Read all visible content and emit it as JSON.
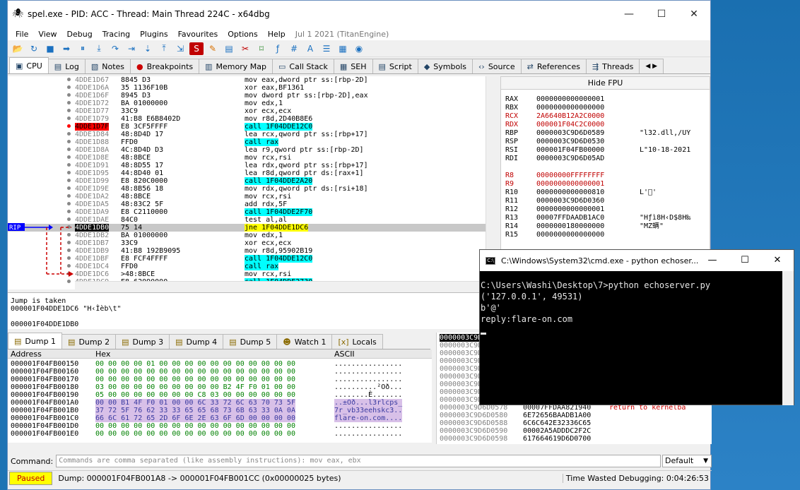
{
  "window": {
    "title": "spel.exe - PID: ACC - Thread: Main Thread 224C - x64dbg"
  },
  "menu": {
    "items": [
      "File",
      "View",
      "Debug",
      "Tracing",
      "Plugins",
      "Favourites",
      "Options",
      "Help"
    ],
    "version": "Jul 1 2021 (TitanEngine)"
  },
  "toolbar": {
    "icons": [
      "open-icon",
      "restart-icon",
      "stop-icon",
      "run-icon",
      "pause-icon",
      "step-into-icon",
      "step-over-icon",
      "trace-into-icon",
      "trace-over-icon",
      "execute-till-return-icon",
      "run-to-user-code-icon",
      "scylla-icon",
      "patch-icon",
      "comment-icon",
      "label-icon",
      "bookmark-icon",
      "function-icon",
      "hash-icon",
      "font-icon",
      "strings-icon",
      "calculator-icon",
      "help-icon"
    ]
  },
  "tabs": [
    {
      "icon": "cpu-icon",
      "label": "CPU",
      "active": true
    },
    {
      "icon": "log-icon",
      "label": "Log"
    },
    {
      "icon": "notes-icon",
      "label": "Notes"
    },
    {
      "icon": "breakpoint-icon",
      "label": "Breakpoints"
    },
    {
      "icon": "memory-icon",
      "label": "Memory Map"
    },
    {
      "icon": "callstack-icon",
      "label": "Call Stack"
    },
    {
      "icon": "seh-icon",
      "label": "SEH"
    },
    {
      "icon": "script-icon",
      "label": "Script"
    },
    {
      "icon": "symbols-icon",
      "label": "Symbols"
    },
    {
      "icon": "source-icon",
      "label": "Source"
    },
    {
      "icon": "references-icon",
      "label": "References"
    },
    {
      "icon": "threads-icon",
      "label": "Threads"
    }
  ],
  "disasm": [
    {
      "addr": "4DDE1D67",
      "bytes": "8845 D3",
      "ins": "mov eax,dword ptr ss:[rbp-2D]"
    },
    {
      "addr": "4DDE1D6A",
      "bytes": "35 1136F10B",
      "ins": "xor eax,BF1361"
    },
    {
      "addr": "4DDE1D6F",
      "bytes": "8945 D3",
      "ins": "mov dword ptr ss:[rbp-2D],eax"
    },
    {
      "addr": "4DDE1D72",
      "bytes": "BA 01000000",
      "ins": "mov edx,1"
    },
    {
      "addr": "4DDE1D77",
      "bytes": "33C9",
      "ins": "xor ecx,ecx"
    },
    {
      "addr": "4DDE1D79",
      "bytes": "41:B8 E6B8402D",
      "ins": "mov r8d,2D40B8E6"
    },
    {
      "addr": "4DDE1D7F",
      "bytes": "E8 3CF5FFFF",
      "ins": "call 1F04DDE12C0",
      "call": true,
      "bp": true
    },
    {
      "addr": "4DDE1D84",
      "bytes": "48:8D4D 17",
      "ins": "lea rcx,qword ptr ss:[rbp+17]"
    },
    {
      "addr": "4DDE1D88",
      "bytes": "FFD0",
      "ins": "call rax",
      "call": true
    },
    {
      "addr": "4DDE1D8A",
      "bytes": "4C:8D4D D3",
      "ins": "lea r9,qword ptr ss:[rbp-2D]"
    },
    {
      "addr": "4DDE1D8E",
      "bytes": "48:8BCE",
      "ins": "mov rcx,rsi"
    },
    {
      "addr": "4DDE1D91",
      "bytes": "48:8D55 17",
      "ins": "lea rdx,qword ptr ss:[rbp+17]"
    },
    {
      "addr": "4DDE1D95",
      "bytes": "44:8D40 01",
      "ins": "lea r8d,qword ptr ds:[rax+1]"
    },
    {
      "addr": "4DDE1D99",
      "bytes": "E8 820C0000",
      "ins": "call 1F04DDE2A20",
      "call": true
    },
    {
      "addr": "4DDE1D9E",
      "bytes": "48:8B56 18",
      "ins": "mov rdx,qword ptr ds:[rsi+18]"
    },
    {
      "addr": "4DDE1DA2",
      "bytes": "48:8BCE",
      "ins": "mov rcx,rsi"
    },
    {
      "addr": "4DDE1DA5",
      "bytes": "48:83C2 5F",
      "ins": "add rdx,5F"
    },
    {
      "addr": "4DDE1DA9",
      "bytes": "E8 C2110000",
      "ins": "call 1F04DDE2F70",
      "call": true
    },
    {
      "addr": "4DDE1DAE",
      "bytes": "84C0",
      "ins": "test al,al"
    },
    {
      "addr": "4DDE1DB0",
      "bytes": "75 14",
      "ins": "jne 1F04DDE1DC6",
      "jmp": true,
      "rip": true
    },
    {
      "addr": "4DDE1DB2",
      "bytes": "BA 01000000",
      "ins": "mov edx,1"
    },
    {
      "addr": "4DDE1DB7",
      "bytes": "33C9",
      "ins": "xor ecx,ecx"
    },
    {
      "addr": "4DDE1DB9",
      "bytes": "41:B8 192B9095",
      "ins": "mov r8d,95902B19"
    },
    {
      "addr": "4DDE1DBF",
      "bytes": "E8 FCF4FFFF",
      "ins": "call 1F04DDE12C0",
      "call": true
    },
    {
      "addr": "4DDE1DC4",
      "bytes": "FFD0",
      "ins": "call rax",
      "call": true
    },
    {
      "addr": "4DDE1DC6",
      "bytes": ">48:8BCE",
      "ins": "mov rcx,rsi"
    },
    {
      "addr": "4DDE1DC9",
      "bytes": "E8 62090000",
      "ins": "call 1F04DDE2730",
      "call": true
    }
  ],
  "rip_label": "RIP",
  "hide_fpu": "Hide FPU",
  "registers": [
    {
      "n": "RAX",
      "v": "0000000000000001",
      "c": ""
    },
    {
      "n": "RBX",
      "v": "0000000000000000",
      "c": ""
    },
    {
      "n": "RCX",
      "v": "2A6640B12A2C0000",
      "c": "",
      "mod": true
    },
    {
      "n": "RDX",
      "v": "000001F04C2C0000",
      "c": "",
      "mod": true
    },
    {
      "n": "RBP",
      "v": "0000003C9D6D0589",
      "c": "\"l32.dll,/UÝ"
    },
    {
      "n": "RSP",
      "v": "0000003C9D6D0530",
      "c": ""
    },
    {
      "n": "RSI",
      "v": "000001F04FB00000",
      "c": "L\"10-18-2021"
    },
    {
      "n": "RDI",
      "v": "0000003C9D6D05AD",
      "c": ""
    },
    {
      "n": "",
      "v": "",
      "c": ""
    },
    {
      "n": "R8",
      "v": "00000000FFFFFFFF",
      "c": "",
      "mod": true
    },
    {
      "n": "R9",
      "v": "0000000000000001",
      "c": "",
      "mod": true
    },
    {
      "n": "R10",
      "v": "0000000000000810",
      "c": "L'\u0000'"
    },
    {
      "n": "R11",
      "v": "0000003C9D6D0360",
      "c": ""
    },
    {
      "n": "R12",
      "v": "0000000000000001",
      "c": ""
    },
    {
      "n": "R13",
      "v": "00007FFDAADB1AC0",
      "c": "\"Hƒì8H‹D$8H‰"
    },
    {
      "n": "R14",
      "v": "0000000180000000",
      "c": "\"MZ螨\""
    },
    {
      "n": "R15",
      "v": "0000000000000000",
      "c": ""
    }
  ],
  "info": {
    "line1": "Jump is taken",
    "line2": "000001F04DDE1DC6 \"H‹Ìèb\\t\"",
    "line3": "",
    "line4": "000001F04DDE1DB0"
  },
  "dump_tabs": [
    {
      "icon": "dump-icon",
      "label": "Dump 1",
      "active": true
    },
    {
      "icon": "dump-icon",
      "label": "Dump 2"
    },
    {
      "icon": "dump-icon",
      "label": "Dump 3"
    },
    {
      "icon": "dump-icon",
      "label": "Dump 4"
    },
    {
      "icon": "dump-icon",
      "label": "Dump 5"
    },
    {
      "icon": "watch-icon",
      "label": "Watch 1"
    },
    {
      "icon": "locals-icon",
      "label": "Locals"
    }
  ],
  "dump_headers": {
    "address": "Address",
    "hex": "Hex",
    "ascii": "ASCII"
  },
  "dump": [
    {
      "a": "000001F04FB00150",
      "h": "00 00 00 00 01 00 00 00 00 00 00 00 00 00 00 00",
      "s": "................"
    },
    {
      "a": "000001F04FB00160",
      "h": "00 00 00 00 00 00 00 00 00 00 00 00 00 00 00 00",
      "s": "................"
    },
    {
      "a": "000001F04FB00170",
      "h": "00 00 00 00 00 00 00 00 00 00 00 00 00 00 00 00",
      "s": "................"
    },
    {
      "a": "000001F04FB00180",
      "h": "03 00 00 00 00 00 00 00 00 00 B2 4F F0 01 00 00",
      "s": "..........²Oð..."
    },
    {
      "a": "000001F04FB00190",
      "h": "05 00 00 00 00 00 00 00 C8 03 00 00 00 00 00 00",
      "s": "........È......."
    },
    {
      "a": "000001F04FB001A0",
      "h": "00 00 B1 4F F0 01 00 00 6C 33 72 6C 63 70 73 5F",
      "s": "..±Oð...l3rlcps_",
      "sel": true
    },
    {
      "a": "000001F04FB001B0",
      "h": "37 72 5F 76 62 33 33 65 65 68 73 6B 63 33 0A 0A",
      "s": "7r_vb33eehskc3..",
      "sel": true
    },
    {
      "a": "000001F04FB001C0",
      "h": "66 6C 61 72 65 2D 6F 6E 2E 63 6F 6D 00 00 00 00",
      "s": "flare-on.com....",
      "sel": true
    },
    {
      "a": "000001F04FB001D0",
      "h": "00 00 00 00 00 00 00 00 00 00 00 00 00 00 00 00",
      "s": "................"
    },
    {
      "a": "000001F04FB001E0",
      "h": "00 00 00 00 00 00 00 00 00 00 00 00 00 00 00 00",
      "s": "................"
    }
  ],
  "stack": [
    {
      "a": "0000003C9D6D0530",
      "v": "",
      "c": "",
      "hl": true
    },
    {
      "a": "0000003C9D6D0538",
      "v": "",
      "c": ""
    },
    {
      "a": "0000003C9D6D0540",
      "v": "",
      "c": ""
    },
    {
      "a": "0000003C9D6D0548",
      "v": "",
      "c": ""
    },
    {
      "a": "0000003C9D6D0550",
      "v": "",
      "c": ""
    },
    {
      "a": "0000003C9D6D0558",
      "v": "",
      "c": ""
    },
    {
      "a": "0000003C9D6D0560",
      "v": "",
      "c": ""
    },
    {
      "a": "0000003C9D6D0568",
      "v": "",
      "c": ""
    },
    {
      "a": "0000003C9D6D0570",
      "v": "",
      "c": ""
    },
    {
      "a": "0000003C9D6D0578",
      "v": "00007FFDAA821940",
      "c": "return to kernelba"
    },
    {
      "a": "0000003C9D6D0580",
      "v": "6E72656BAADB1A00",
      "c": ""
    },
    {
      "a": "0000003C9D6D0588",
      "v": "6C6C642E32336C65",
      "c": ""
    },
    {
      "a": "0000003C9D6D0590",
      "v": "00002A5ADDDC2F2C",
      "c": ""
    },
    {
      "a": "0000003C9D6D0598",
      "v": "617664619D6D0700",
      "c": ""
    }
  ],
  "command": {
    "label": "Command:",
    "placeholder": "Commands are comma separated (like assembly instructions): mov eax, ebx",
    "mode": "Default"
  },
  "status": {
    "state": "Paused",
    "message": "Dump: 000001F04FB001A8 -> 000001F04FB001CC (0x00000025 bytes)",
    "time": "Time Wasted Debugging: 0:04:26:53"
  },
  "cmd": {
    "title": "C:\\Windows\\System32\\cmd.exe - python  echoser...",
    "lines": [
      "C:\\Users\\Washi\\Desktop\\7>python echoserver.py",
      "('127.0.0.1', 49531)",
      "b'@'",
      "reply:flare-on.com"
    ]
  },
  "colors": {
    "accent": "#00ffff",
    "jump": "#ffff00",
    "breakpoint": "#ff0000",
    "rip": "#0000ff"
  }
}
